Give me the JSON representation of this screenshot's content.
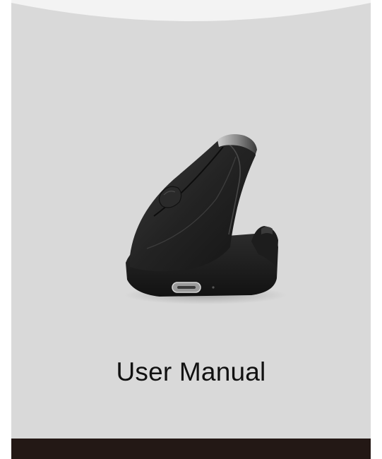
{
  "cover": {
    "title": "User Manual",
    "product_image": "vertical-ergonomic-mouse",
    "colors": {
      "background": "#d9d9d9",
      "page_margin": "#ffffff",
      "footer_band": "#231815",
      "title_text": "#111111"
    }
  }
}
